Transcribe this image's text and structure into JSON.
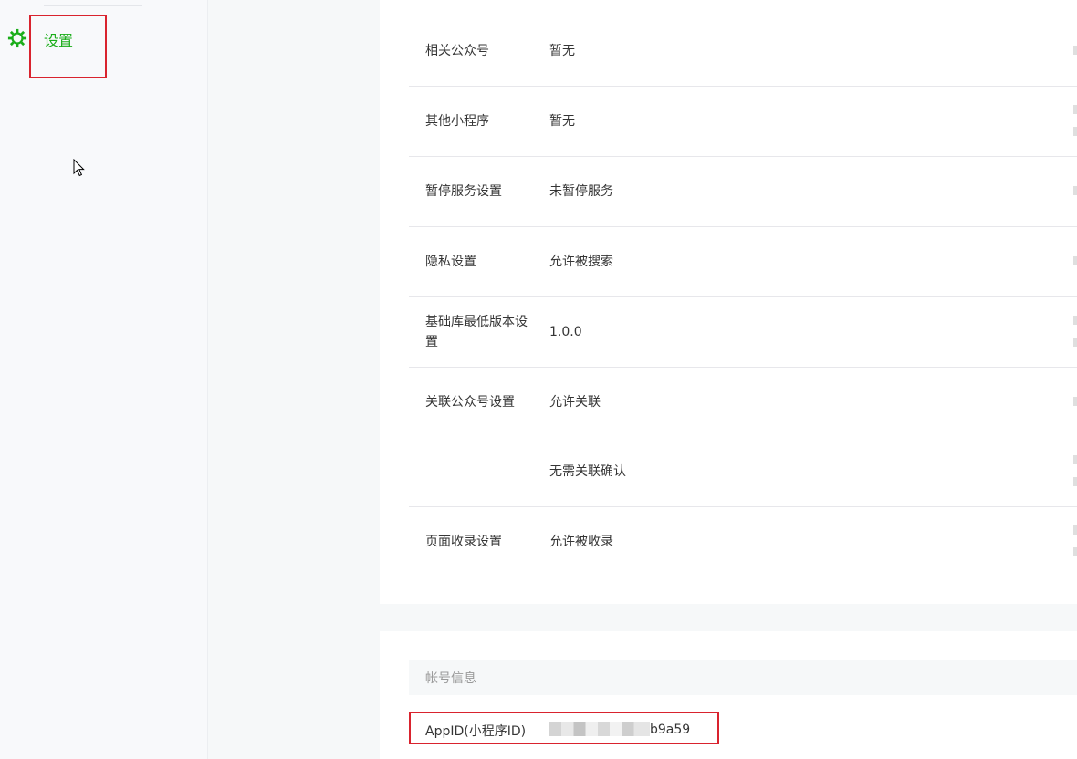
{
  "sidebar": {
    "settings_label": "设置",
    "settings_icon": "gear-icon",
    "accent_color": "#1aad19"
  },
  "settings_rows": [
    {
      "key": "相关公众号",
      "value": "暂无"
    },
    {
      "key": "其他小程序",
      "value": "暂无"
    },
    {
      "key": "暂停服务设置",
      "value": "未暂停服务"
    },
    {
      "key": "隐私设置",
      "value": "允许被搜索"
    },
    {
      "key": "基础库最低版本设置",
      "value": "1.0.0"
    },
    {
      "key": "关联公众号设置",
      "value": "允许关联",
      "value2": "无需关联确认"
    },
    {
      "key": "页面收录设置",
      "value": "允许被收录"
    }
  ],
  "account_section": {
    "title": "帐号信息",
    "appid_label": "AppID(小程序ID)",
    "appid_visible_suffix": "b9a59"
  },
  "highlight_color": "#d9232e"
}
